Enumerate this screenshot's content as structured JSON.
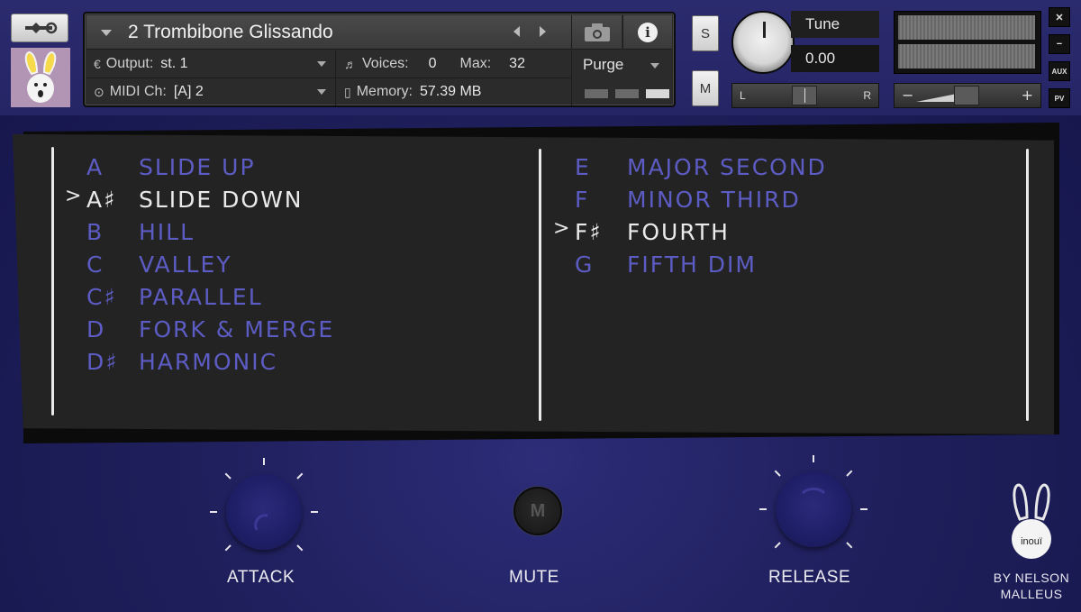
{
  "header": {
    "instrument_title": "2 Trombibone Glissando",
    "output_label": "Output:",
    "output_value": "st. 1",
    "voices_label": "Voices:",
    "voices_value": "0",
    "max_label": "Max:",
    "max_value": "32",
    "midi_label": "MIDI Ch:",
    "midi_value": "[A]  2",
    "memory_label": "Memory:",
    "memory_value": "57.39 MB",
    "purge_label": "Purge",
    "solo_label": "S",
    "mute_label": "M",
    "tune_label": "Tune",
    "tune_value": "0.00",
    "pan_left": "L",
    "pan_right": "R",
    "vol_minus": "−",
    "vol_plus": "+",
    "close_label": "✕",
    "minimize_label": "−",
    "aux_label": "AUX",
    "pv_label": "PV"
  },
  "articulations_left": [
    {
      "key": "A",
      "name": "SLIDE UP",
      "selected": false
    },
    {
      "key": "A♯",
      "name": "SLIDE DOWN",
      "selected": true
    },
    {
      "key": "B",
      "name": "HILL",
      "selected": false
    },
    {
      "key": "C",
      "name": "VALLEY",
      "selected": false
    },
    {
      "key": "C♯",
      "name": "PARALLEL",
      "selected": false
    },
    {
      "key": "D",
      "name": "FORK & MERGE",
      "selected": false
    },
    {
      "key": "D♯",
      "name": "HARMONIC",
      "selected": false
    }
  ],
  "articulations_right": [
    {
      "key": "E",
      "name": "MAJOR SECOND",
      "selected": false
    },
    {
      "key": "F",
      "name": "MINOR THIRD",
      "selected": false
    },
    {
      "key": "F♯",
      "name": "FOURTH",
      "selected": true
    },
    {
      "key": "G",
      "name": "FIFTH DIM",
      "selected": false
    }
  ],
  "pointer_glyph": ">",
  "controls": {
    "attack_label": "ATTACK",
    "mute_label": "MUTE",
    "mute_glyph": "M",
    "release_label": "RELEASE"
  },
  "brand": {
    "logo_text": "inouï",
    "line1": "BY NELSON",
    "line2": "MALLEUS"
  },
  "colors": {
    "background": "#1f1f5c",
    "item_inactive": "#5c5cc4",
    "item_selected": "#eaeaea",
    "panel": "#232323"
  }
}
